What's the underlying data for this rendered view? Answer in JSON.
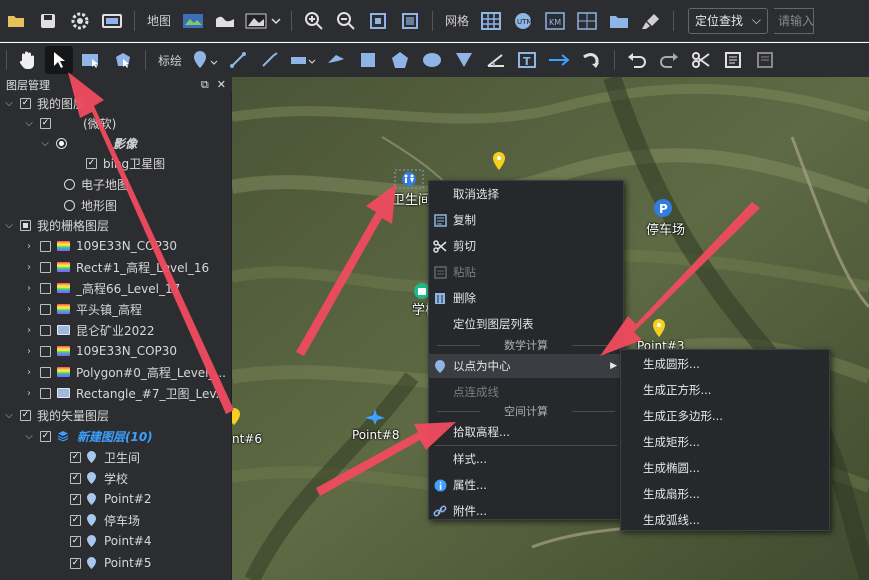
{
  "toolbar1": {
    "map_label": "地图",
    "grid_label": "网格",
    "locate_select": "定位查找",
    "search_placeholder": "请输入"
  },
  "toolbar2": {
    "mark_label": "标绘"
  },
  "panel": {
    "title": "图层管理",
    "items": [
      {
        "label": "我的图层"
      },
      {
        "label": "(微软)"
      },
      {
        "label": "影像"
      },
      {
        "label": "bing卫星图"
      },
      {
        "label": "电子地图"
      },
      {
        "label": "地形图"
      },
      {
        "label": "我的栅格图层"
      },
      {
        "label": "109E33N_COP30"
      },
      {
        "label": "Rect#1_高程_Level_16"
      },
      {
        "label": "_高程66_Level_17"
      },
      {
        "label": "平头镇_高程"
      },
      {
        "label": "昆仑矿业2022"
      },
      {
        "label": "109E33N_COP30"
      },
      {
        "label": "Polygon#0_高程_Level_..."
      },
      {
        "label": "Rectangle_#7_卫图_Lev..."
      },
      {
        "label": "我的矢量图层"
      },
      {
        "label": "新建图层(10)"
      },
      {
        "label": "卫生间"
      },
      {
        "label": "学校"
      },
      {
        "label": "Point#2"
      },
      {
        "label": "停车场"
      },
      {
        "label": "Point#4"
      },
      {
        "label": "Point#5"
      }
    ]
  },
  "map": {
    "labels": {
      "toilet": "卫生间",
      "parking": "停车场",
      "school": "学校",
      "point8": "Point#8",
      "point6": "nt#6",
      "point3": "Point#3"
    }
  },
  "context_menu": {
    "items": {
      "deselect": "取消选择",
      "copy": "复制",
      "cut": "剪切",
      "paste": "粘贴",
      "delete": "删除",
      "locate_layer": "定位到图层列表",
      "math_header": "数学计算",
      "center_point": "以点为中心",
      "connect_line": "点连成线",
      "spatial_header": "空间计算",
      "pick_elevation": "拾取高程...",
      "style": "样式...",
      "properties": "属性...",
      "attachments": "附件..."
    }
  },
  "submenu": {
    "items": [
      "生成圆形...",
      "生成正方形...",
      "生成正多边形...",
      "生成矩形...",
      "生成椭圆...",
      "生成扇形...",
      "生成弧线..."
    ]
  },
  "colors": {
    "accent": "#3ea0ff",
    "arrow": "#f04b5e",
    "panel_bg": "#2b2d30"
  }
}
